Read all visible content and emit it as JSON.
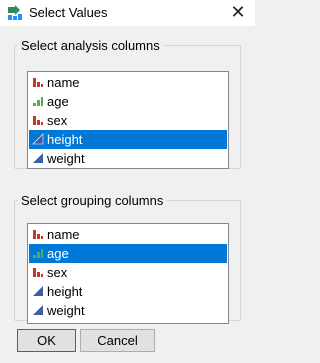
{
  "window": {
    "title": "Select Values",
    "close_glyph": "✕"
  },
  "analysis": {
    "legend": "Select analysis columns",
    "items": [
      {
        "label": "name",
        "icon": "nominal-bar-icon",
        "selected": false
      },
      {
        "label": "age",
        "icon": "ordinal-bar-icon",
        "selected": false
      },
      {
        "label": "sex",
        "icon": "nominal-bar-icon",
        "selected": false
      },
      {
        "label": "height",
        "icon": "continuous-triangle-icon",
        "selected": true
      },
      {
        "label": "weight",
        "icon": "continuous-triangle-icon",
        "selected": false
      }
    ]
  },
  "grouping": {
    "legend": "Select grouping columns",
    "items": [
      {
        "label": "name",
        "icon": "nominal-bar-icon",
        "selected": false
      },
      {
        "label": "age",
        "icon": "ordinal-bar-icon",
        "selected": true
      },
      {
        "label": "sex",
        "icon": "nominal-bar-icon",
        "selected": false
      },
      {
        "label": "height",
        "icon": "continuous-triangle-icon",
        "selected": false
      },
      {
        "label": "weight",
        "icon": "continuous-triangle-icon",
        "selected": false
      }
    ]
  },
  "buttons": {
    "ok": "OK",
    "cancel": "Cancel"
  },
  "colors": {
    "selection": "#0078d7",
    "nominal": "#c0392b",
    "ordinal": "#4caf50",
    "continuous": "#3a5fa8"
  }
}
